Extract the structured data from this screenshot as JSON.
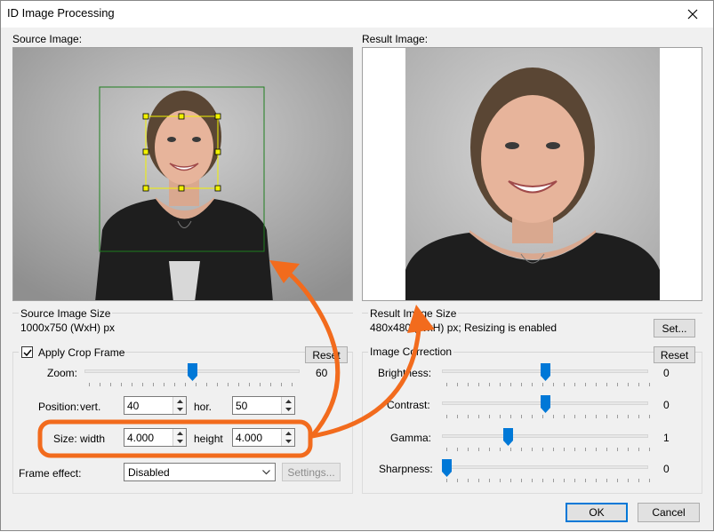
{
  "window": {
    "title": "ID Image Processing"
  },
  "source": {
    "label": "Source Image:",
    "size_group": "Source Image Size",
    "size_text": "1000x750 (WxH) px"
  },
  "result": {
    "label": "Result Image:",
    "size_group": "Result Image Size",
    "size_text": "480x480 (WxH) px; Resizing is enabled",
    "set_button": "Set..."
  },
  "crop": {
    "checkbox_label": "Apply Crop Frame",
    "checked": true,
    "reset_button": "Reset",
    "zoom_label": "Zoom:",
    "zoom_value": "60",
    "zoom_level": 0.5,
    "position_label": "Position:",
    "vert_label": "vert.",
    "vert_value": "40",
    "hor_label": "hor.",
    "hor_value": "50",
    "size_label": "Size:",
    "width_label": "width",
    "width_value": "4.000",
    "height_label": "height",
    "height_value": "4.000",
    "frame_effect_label": "Frame effect:",
    "frame_effect_value": "Disabled",
    "settings_button": "Settings..."
  },
  "correction": {
    "group_title": "Image Correction",
    "reset_button": "Reset",
    "sliders": [
      {
        "label": "Brightness:",
        "value": "0",
        "level": 0.5
      },
      {
        "label": "Contrast:",
        "value": "0",
        "level": 0.5
      },
      {
        "label": "Gamma:",
        "value": "1",
        "level": 0.32
      },
      {
        "label": "Sharpness:",
        "value": "0",
        "level": 0.0
      }
    ]
  },
  "footer": {
    "ok_button": "OK",
    "cancel_button": "Cancel"
  },
  "colors": {
    "accent": "#0078d7",
    "annotation": "#f26b1d",
    "crop_frame": "#f2f200",
    "outer_frame": "#1f7f1f"
  },
  "icons": [
    "close-icon",
    "checkmark-icon",
    "spin-up-icon",
    "spin-down-icon",
    "chevron-down-icon",
    "slider-thumb-icon"
  ]
}
